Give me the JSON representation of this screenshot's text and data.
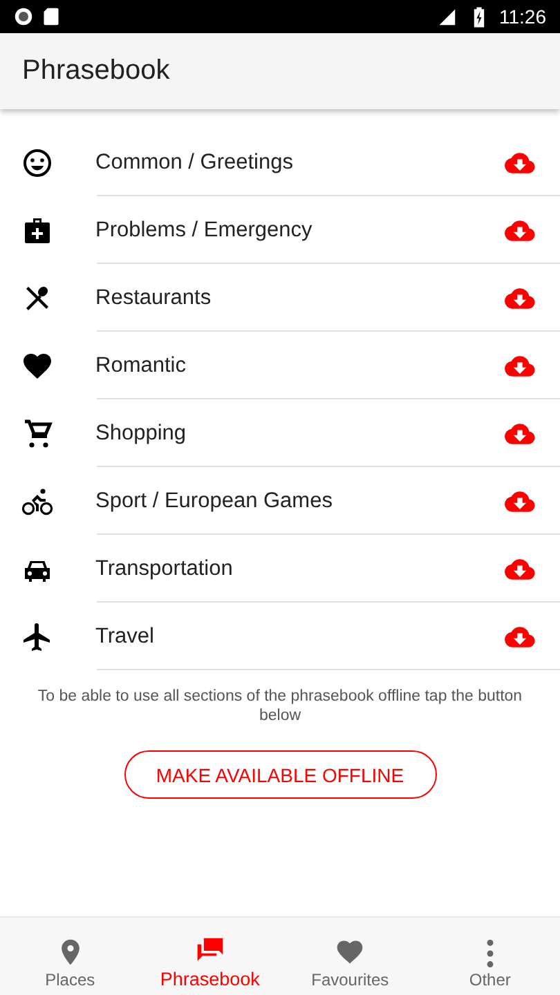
{
  "status_bar": {
    "time": "11:26"
  },
  "app_bar": {
    "title": "Phrasebook"
  },
  "sections": [
    {
      "kind": "smiley",
      "label": "Common / Greetings"
    },
    {
      "kind": "medkit",
      "label": "Problems / Emergency"
    },
    {
      "kind": "cutlery",
      "label": "Restaurants"
    },
    {
      "kind": "heart",
      "label": "Romantic"
    },
    {
      "kind": "cart",
      "label": "Shopping"
    },
    {
      "kind": "bike",
      "label": "Sport / European Games"
    },
    {
      "kind": "car",
      "label": "Transportation"
    },
    {
      "kind": "plane",
      "label": "Travel"
    }
  ],
  "offline_note": "To be able to use all sections of the phrasebook offline tap the button below",
  "offline_button": "MAKE AVAILABLE OFFLINE",
  "bottom_nav": [
    {
      "kind": "pin",
      "label": "Places",
      "selected": false
    },
    {
      "kind": "chat",
      "label": "Phrasebook",
      "selected": true
    },
    {
      "kind": "heart",
      "label": "Favourites",
      "selected": false
    },
    {
      "kind": "more",
      "label": "Other",
      "selected": false
    }
  ]
}
